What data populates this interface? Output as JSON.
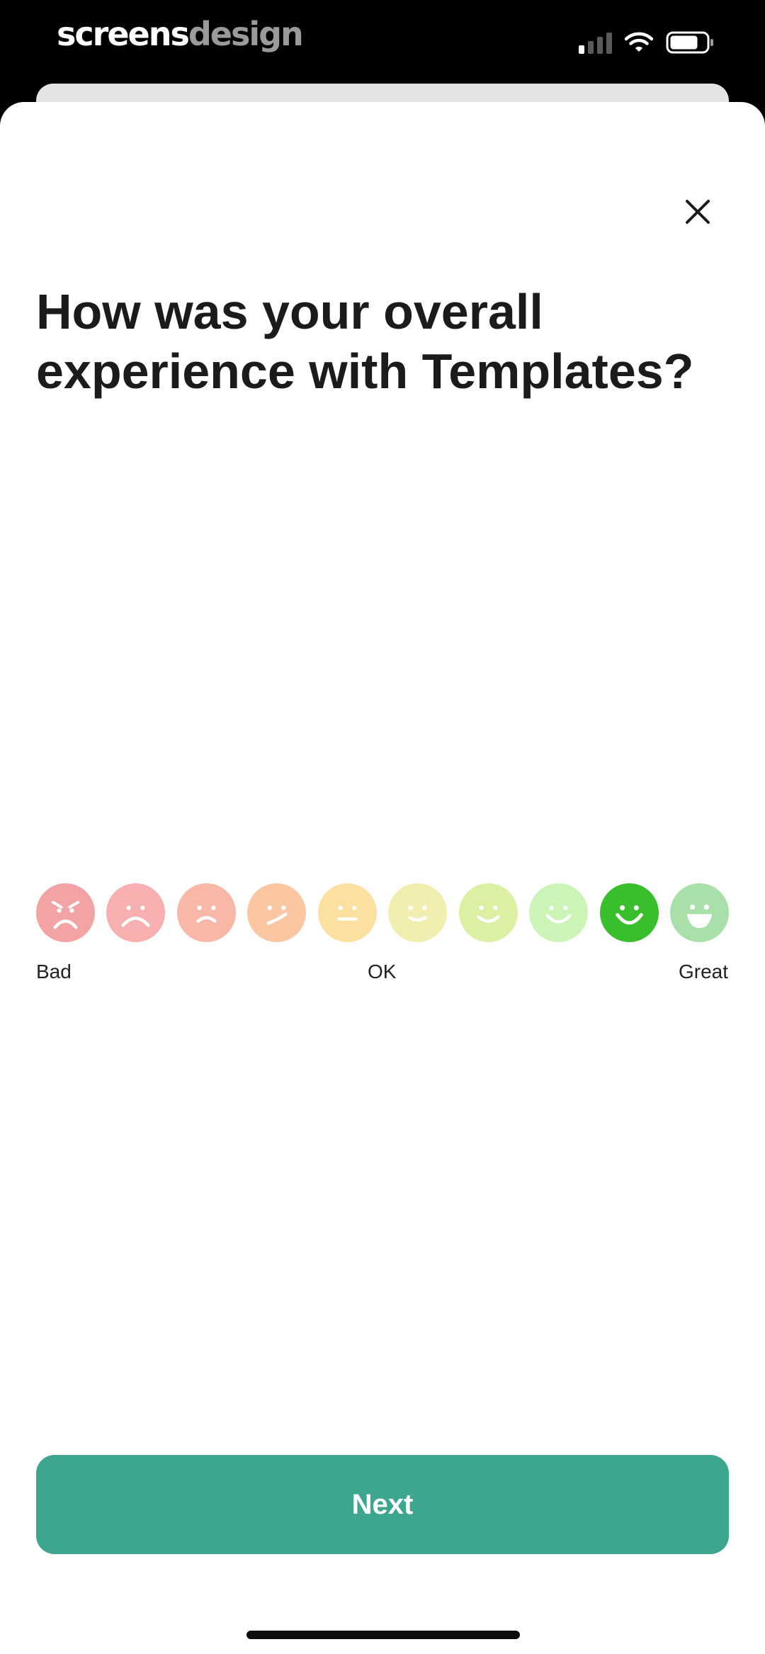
{
  "status_bar": {
    "brand_part1": "screens",
    "brand_part2": "design",
    "icons": [
      "cellular-signal-icon",
      "wifi-icon",
      "battery-icon"
    ]
  },
  "header": {
    "close_icon": "close-icon"
  },
  "question": {
    "title": "How was your overall experience with Templates?"
  },
  "rating": {
    "selected_index": 8,
    "faces": [
      {
        "icon": "angry-face-icon",
        "color": "#f3a3a4"
      },
      {
        "icon": "sad-face-icon",
        "color": "#f7afaf"
      },
      {
        "icon": "frown-face-icon",
        "color": "#f8b7a7"
      },
      {
        "icon": "confused-face-icon",
        "color": "#fbc6a2"
      },
      {
        "icon": "neutral-face-icon",
        "color": "#fbe09f"
      },
      {
        "icon": "slight-smile-face-icon",
        "color": "#f1eeb0"
      },
      {
        "icon": "smile-face-icon",
        "color": "#dcf0a4"
      },
      {
        "icon": "happy-face-icon",
        "color": "#cdf4b7"
      },
      {
        "icon": "big-smile-face-icon",
        "color": "#3abf2c"
      },
      {
        "icon": "grin-face-icon",
        "color": "#a9dfa8"
      }
    ],
    "label_low": "Bad",
    "label_mid": "OK",
    "label_high": "Great"
  },
  "footer": {
    "next_label": "Next",
    "accent_color": "#3ca68f"
  }
}
